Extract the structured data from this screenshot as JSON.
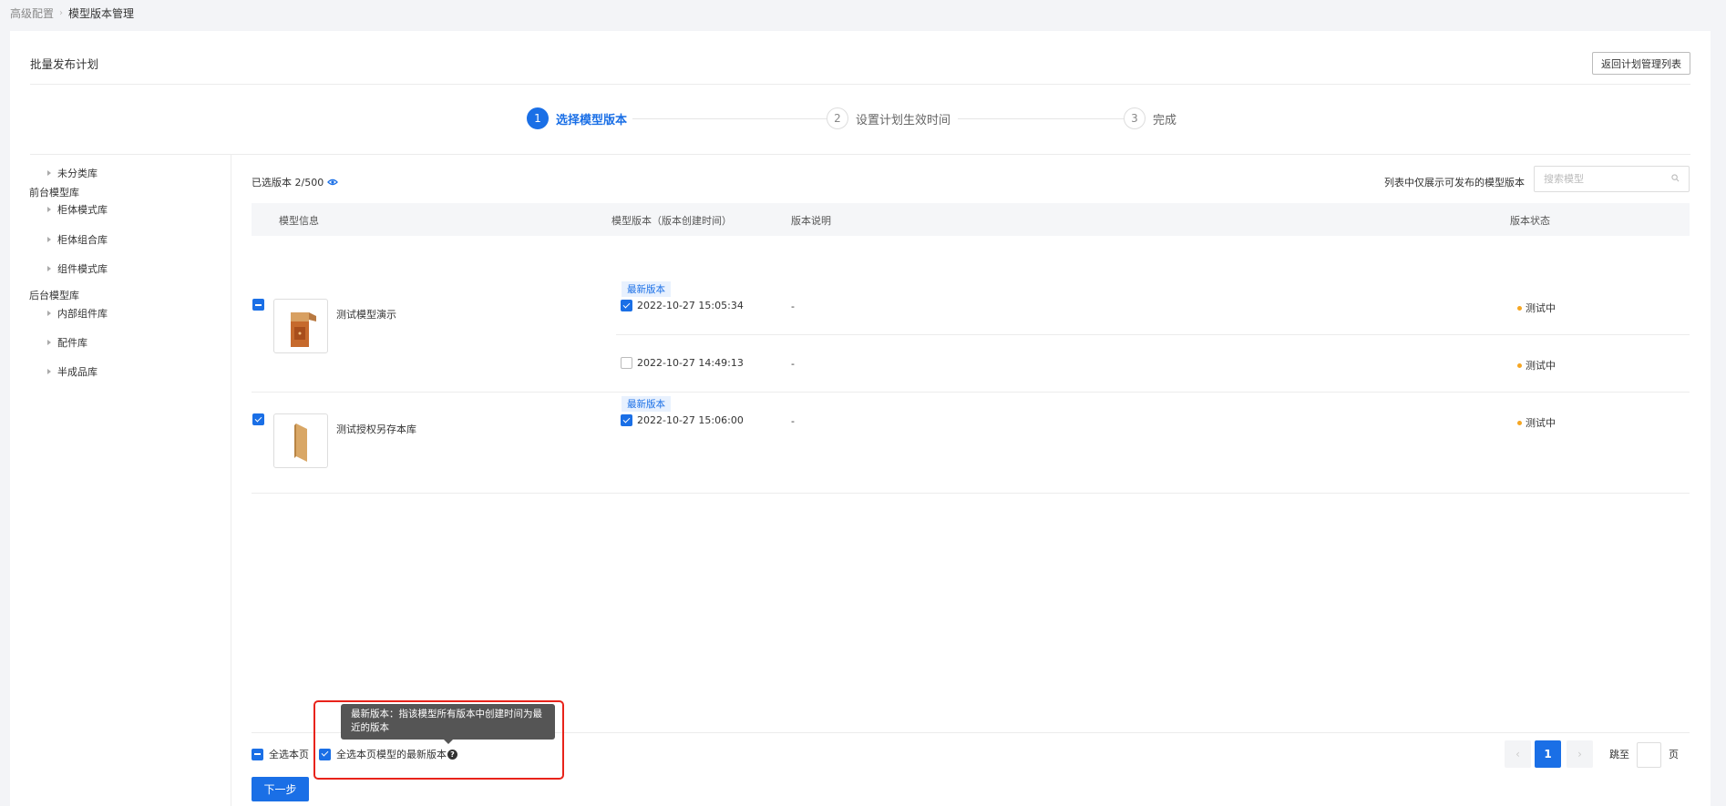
{
  "breadcrumb": {
    "parent": "高级配置",
    "current": "模型版本管理"
  },
  "header": {
    "title": "批量发布计划",
    "back_button": "返回计划管理列表"
  },
  "steps": [
    {
      "number": "1",
      "label": "选择模型版本",
      "state": "active"
    },
    {
      "number": "2",
      "label": "设置计划生效时间",
      "state": "pending"
    },
    {
      "number": "3",
      "label": "完成",
      "state": "pending"
    }
  ],
  "sidebar": {
    "items": [
      {
        "label": "未分类库",
        "type": "item"
      },
      {
        "label": "前台模型库",
        "type": "group"
      },
      {
        "label": "柜体模式库",
        "type": "item"
      },
      {
        "label": "柜体组合库",
        "type": "item"
      },
      {
        "label": "组件模式库",
        "type": "item"
      },
      {
        "label": "后台模型库",
        "type": "group"
      },
      {
        "label": "内部组件库",
        "type": "item"
      },
      {
        "label": "配件库",
        "type": "item"
      },
      {
        "label": "半成品库",
        "type": "item"
      }
    ]
  },
  "toolbar": {
    "selected_count": "已选版本 2/500",
    "hint": "列表中仅展示可发布的模型版本",
    "search_placeholder": "搜索模型"
  },
  "table": {
    "columns": [
      "模型信息",
      "模型版本（版本创建时间）",
      "版本说明",
      "版本状态"
    ],
    "rows": [
      {
        "model_name": "测试模型演示",
        "model_checked": "partial",
        "versions": [
          {
            "tag": "最新版本",
            "time": "2022-10-27 15:05:34",
            "checked": true,
            "desc": "-",
            "status": "测试中"
          },
          {
            "tag": "",
            "time": "2022-10-27 14:49:13",
            "checked": false,
            "desc": "-",
            "status": "测试中"
          }
        ]
      },
      {
        "model_name": "测试授权另存本库",
        "model_checked": "checked",
        "versions": [
          {
            "tag": "最新版本",
            "time": "2022-10-27 15:06:00",
            "checked": true,
            "desc": "-",
            "status": "测试中"
          }
        ]
      }
    ]
  },
  "footer": {
    "select_page": "全选本页",
    "select_latest": "全选本页模型的最新版本",
    "tooltip": "最新版本：指该模型所有版本中创建时间为最近的版本",
    "next_button": "下一步",
    "pager": {
      "current_page": "1",
      "jump_label": "跳至",
      "page_suffix": "页"
    }
  },
  "colors": {
    "primary": "#1a6fe6",
    "status_testing": "#f5a623",
    "highlight": "#e8231a"
  }
}
